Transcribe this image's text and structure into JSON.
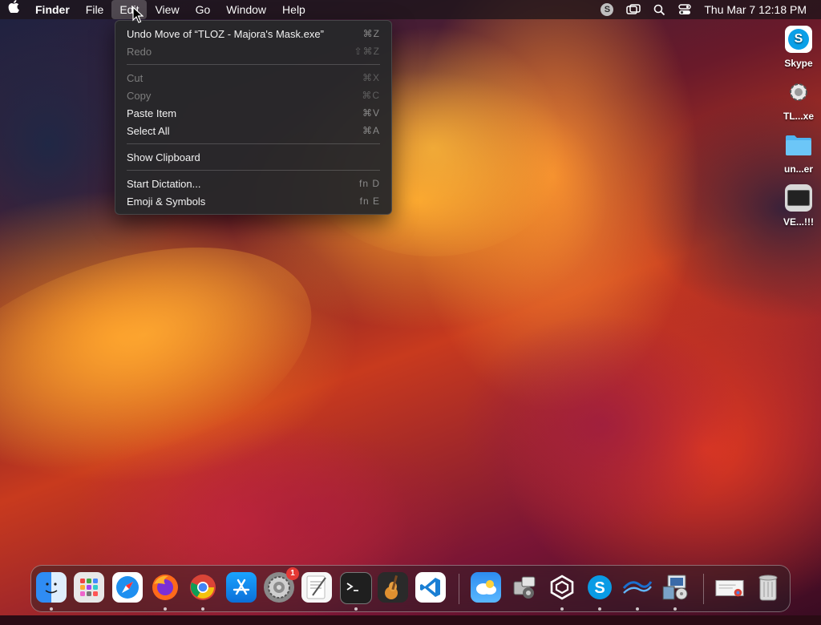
{
  "menubar": {
    "apple_icon": "apple-logo-icon",
    "app_name": "Finder",
    "menus": [
      "File",
      "Edit",
      "View",
      "Go",
      "Window",
      "Help"
    ],
    "active_menu": "Edit",
    "status_icons": [
      "skype-status-icon",
      "screen-mirroring-icon",
      "spotlight-search-icon",
      "control-center-icon"
    ],
    "clock": "Thu Mar 7  12:18 PM"
  },
  "edit_menu": {
    "items": [
      {
        "label": "Undo Move of “TLOZ - Majora's Mask.exe”",
        "shortcut": "⌘Z",
        "enabled": true
      },
      {
        "label": "Redo",
        "shortcut": "⇧⌘Z",
        "enabled": false
      },
      {
        "label": "Cut",
        "shortcut": "⌘X",
        "enabled": false
      },
      {
        "label": "Copy",
        "shortcut": "⌘C",
        "enabled": false
      },
      {
        "label": "Paste Item",
        "shortcut": "⌘V",
        "enabled": true
      },
      {
        "label": "Select All",
        "shortcut": "⌘A",
        "enabled": true
      },
      {
        "label": "Show Clipboard",
        "shortcut": "",
        "enabled": true
      },
      {
        "label": "Start Dictation...",
        "shortcut": "fn D",
        "enabled": true
      },
      {
        "label": "Emoji & Symbols",
        "shortcut": "fn E",
        "enabled": true
      }
    ]
  },
  "desktop_icons": [
    {
      "label": "Skype",
      "icon": "skype-icon"
    },
    {
      "label": "TL...xe",
      "icon": "gear-exe-icon"
    },
    {
      "label": "un...er",
      "icon": "folder-icon"
    },
    {
      "label": "VE...!!!",
      "icon": "video-file-icon"
    }
  ],
  "dock": {
    "apps": [
      {
        "name": "Finder",
        "icon": "finder-icon",
        "running": true
      },
      {
        "name": "Launchpad",
        "icon": "launchpad-icon",
        "running": false
      },
      {
        "name": "Safari",
        "icon": "safari-icon",
        "running": false
      },
      {
        "name": "Firefox",
        "icon": "firefox-icon",
        "running": true
      },
      {
        "name": "Chrome",
        "icon": "chrome-icon",
        "running": true
      },
      {
        "name": "App Store",
        "icon": "app-store-icon",
        "running": false
      },
      {
        "name": "System Settings",
        "icon": "system-settings-icon",
        "running": false,
        "badge": "1"
      },
      {
        "name": "TextEdit",
        "icon": "textedit-icon",
        "running": false
      },
      {
        "name": "Terminal",
        "icon": "terminal-icon",
        "running": true
      },
      {
        "name": "GarageBand",
        "icon": "garageband-icon",
        "running": false
      },
      {
        "name": "Visual Studio Code",
        "icon": "vscode-icon",
        "running": false
      },
      {
        "name": "Weather",
        "icon": "weather-icon",
        "running": false
      },
      {
        "name": "Migration Assistant",
        "icon": "migration-icon",
        "running": false
      },
      {
        "name": "Unity",
        "icon": "unity-icon",
        "running": true
      },
      {
        "name": "Skype",
        "icon": "skype-icon",
        "running": true
      },
      {
        "name": "Wine",
        "icon": "wine-icon",
        "running": true
      },
      {
        "name": "Installer",
        "icon": "installer-icon",
        "running": true
      },
      {
        "name": "Downloads",
        "icon": "downloads-stack-icon",
        "running": false
      },
      {
        "name": "Trash",
        "icon": "trash-icon",
        "running": false
      }
    ]
  }
}
